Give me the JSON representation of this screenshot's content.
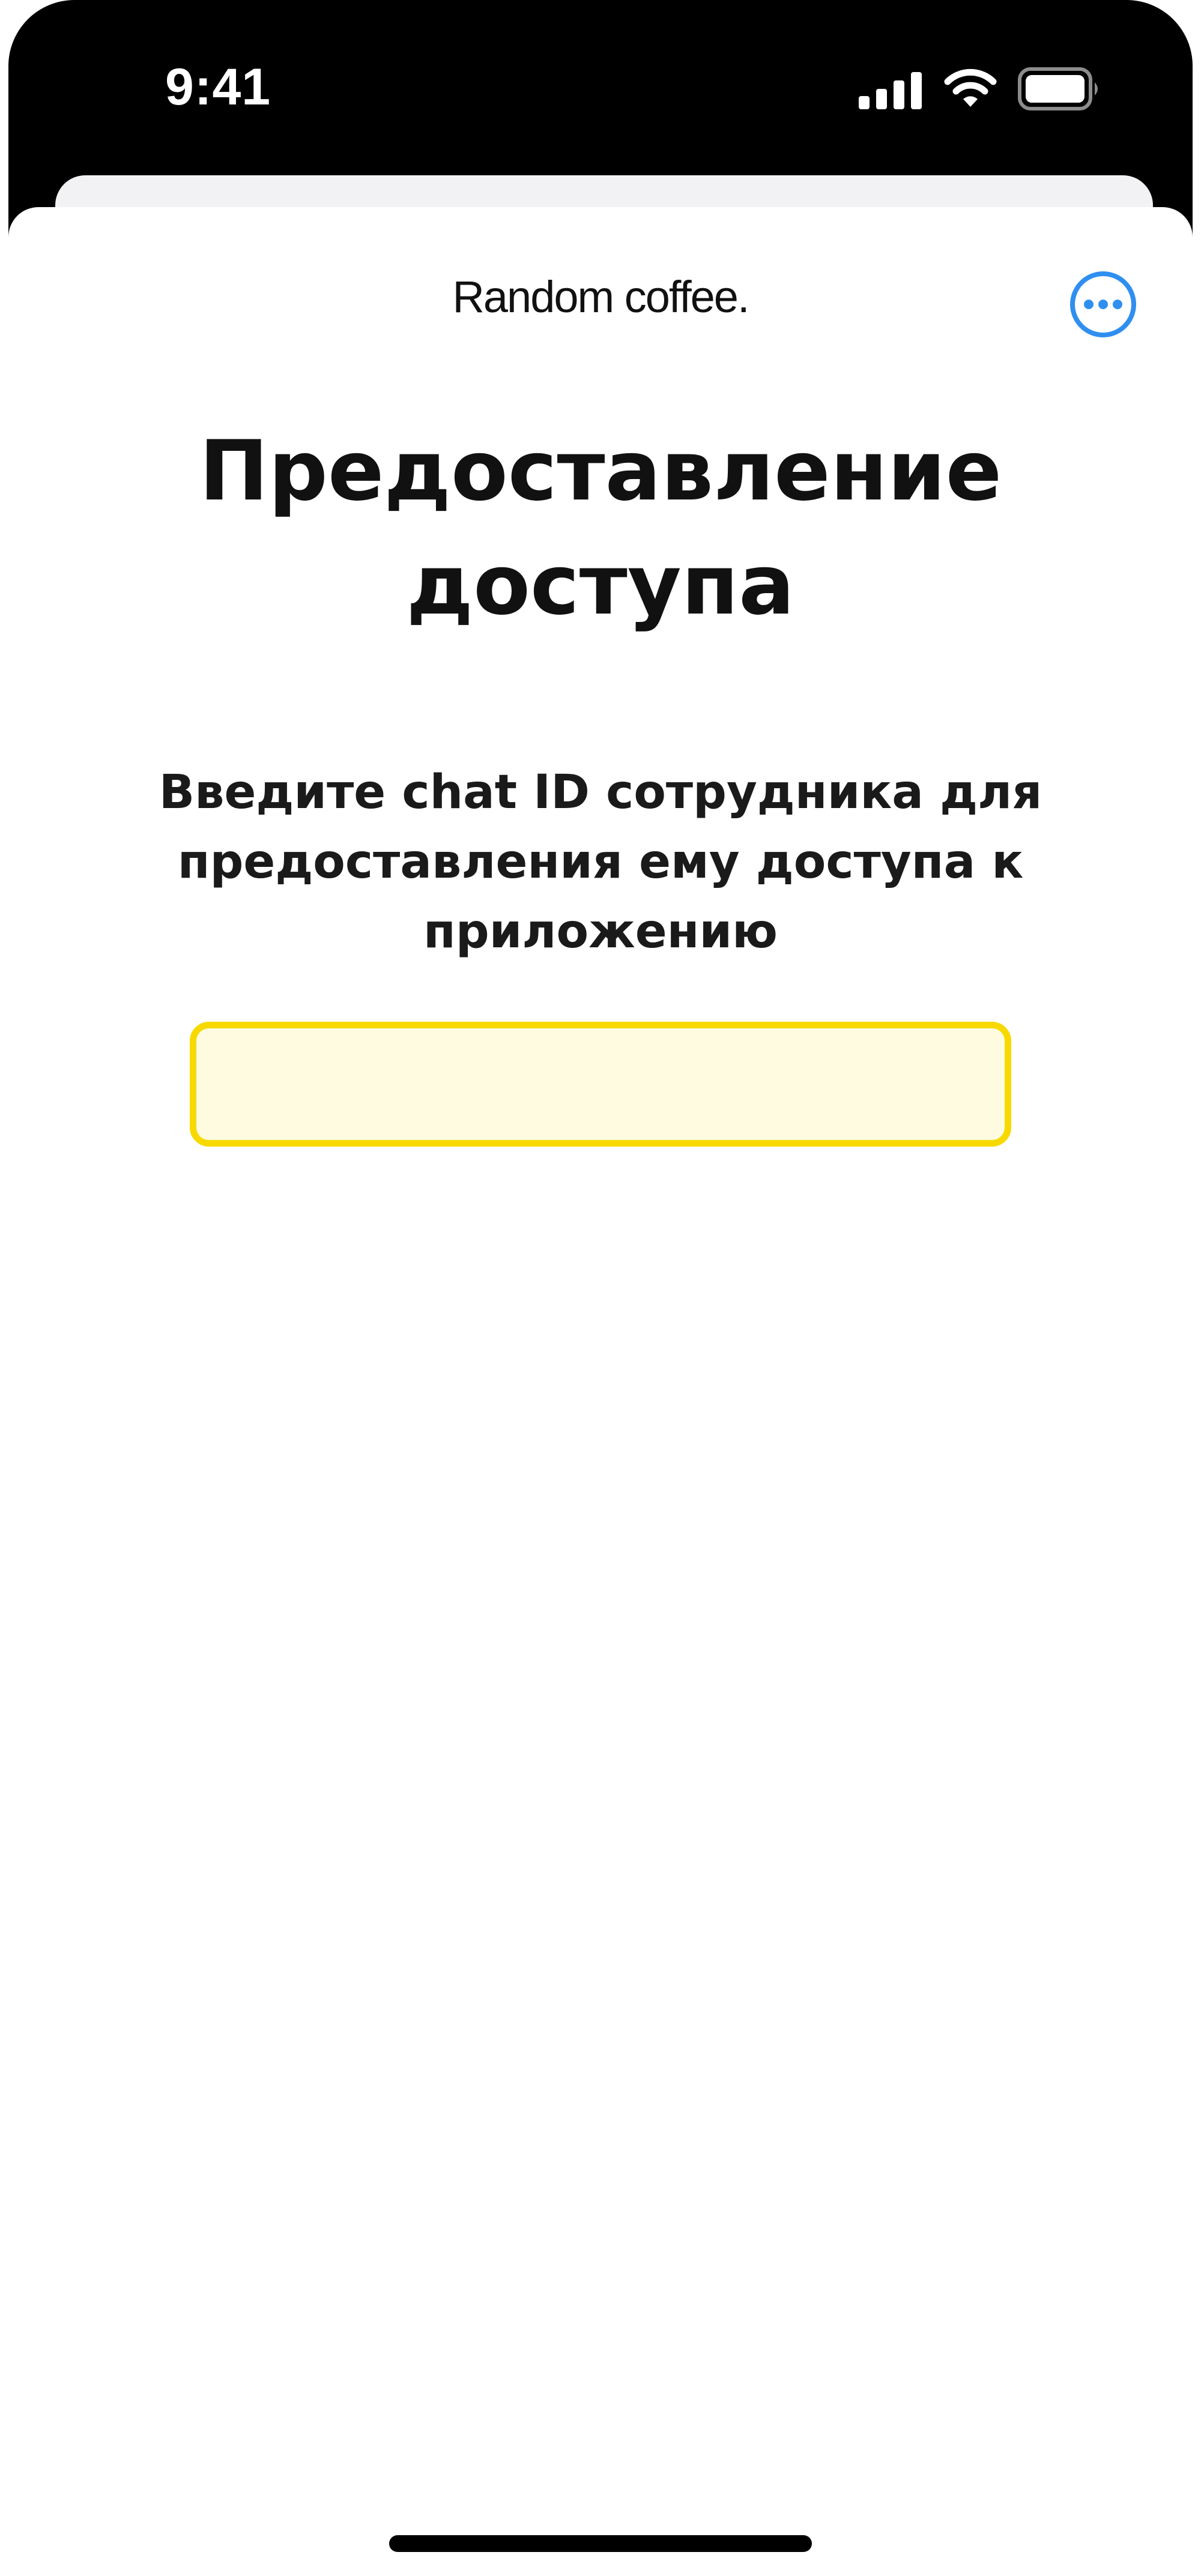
{
  "status_bar": {
    "time": "9:41",
    "icons": [
      "cellular-signal-icon",
      "wifi-icon",
      "battery-icon"
    ]
  },
  "header": {
    "app_title": "Random coffee.",
    "more_icon": "ellipsis-circle-icon"
  },
  "main": {
    "title": "Предоставление доступа",
    "instruction": "Введите chat ID сотрудника для предоставления ему доступа к приложению",
    "chat_id_input": {
      "value": "",
      "placeholder": ""
    }
  },
  "colors": {
    "accent_blue": "#2f8ff0",
    "input_border": "#f7d900",
    "input_background": "#fffbe0",
    "text": "#111111"
  }
}
